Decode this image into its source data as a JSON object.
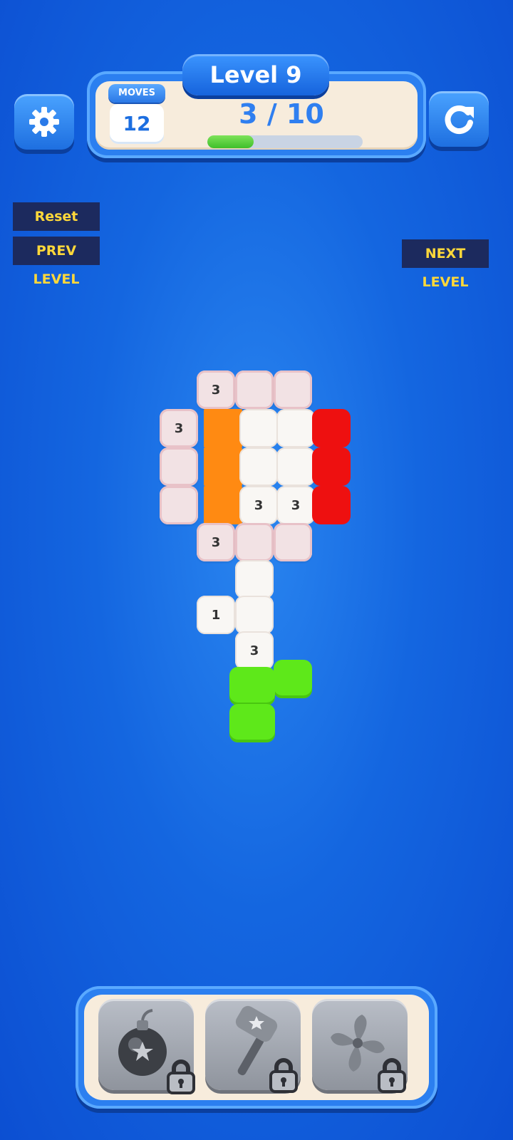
{
  "header": {
    "level_label": "Level 9",
    "moves_label": "MOVES",
    "moves_value": "12",
    "progress_text": "3 / 10",
    "progress_fraction": 0.3
  },
  "debug": {
    "reset": "Reset",
    "prev_level": "PREV LEVEL",
    "next_level": "NEXT LEVEL"
  },
  "board": {
    "numbers": [
      "3",
      "3",
      "3",
      "3",
      "3",
      "1",
      "3"
    ]
  },
  "boosters": [
    {
      "name": "bomb",
      "locked": true
    },
    {
      "name": "hammer",
      "locked": true
    },
    {
      "name": "fan",
      "locked": true
    }
  ],
  "colors": {
    "background": "#1466e0",
    "pink_block": "#f2e2e4",
    "orange_block": "#ff8a12",
    "red_block": "#ee1010",
    "green_block": "#5ee81a",
    "debug_text": "#ffd83a"
  }
}
